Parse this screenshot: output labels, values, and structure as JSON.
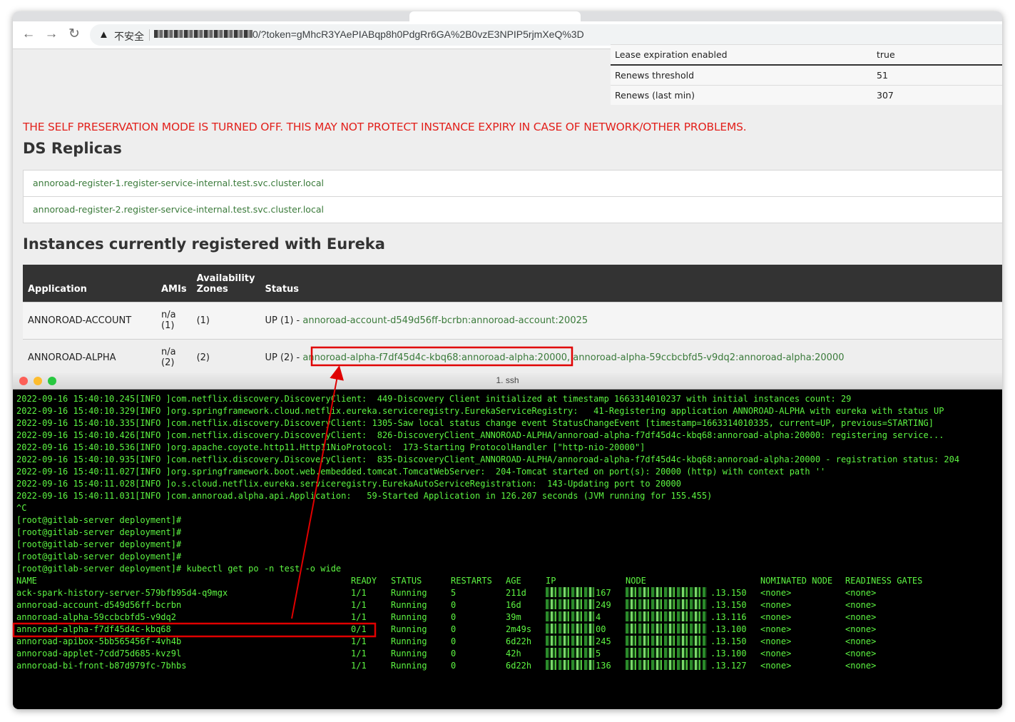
{
  "browser": {
    "security_label": "不安全",
    "url": "0/?token=gMhcR3YAePIABqp8h0PdgRr6GA%2B0vzE3NPIP5rjmXeQ%3D"
  },
  "lease_table": [
    {
      "label": "Lease expiration enabled",
      "value": "true"
    },
    {
      "label": "Renews threshold",
      "value": "51"
    },
    {
      "label": "Renews (last min)",
      "value": "307"
    }
  ],
  "warning": "THE SELF PRESERVATION MODE IS TURNED OFF. THIS MAY NOT PROTECT INSTANCE EXPIRY IN CASE OF NETWORK/OTHER PROBLEMS.",
  "ds_replicas": {
    "title": "DS Replicas",
    "items": [
      "annoroad-register-1.register-service-internal.test.svc.cluster.local",
      "annoroad-register-2.register-service-internal.test.svc.cluster.local"
    ]
  },
  "instances": {
    "title": "Instances currently registered with Eureka",
    "headers": {
      "application": "Application",
      "amis": "AMIs",
      "az_line1": "Availability",
      "az_line2": "Zones",
      "status": "Status"
    },
    "rows": [
      {
        "application": "ANNOROAD-ACCOUNT",
        "amis_1": "n/a",
        "amis_2": "(1)",
        "zones": "(1)",
        "status_prefix": "UP (1) -",
        "link1": "annoroad-account-d549d56ff-bcrbn:annoroad-account:20025",
        "link2": ""
      },
      {
        "application": "ANNOROAD-ALPHA",
        "amis_1": "n/a",
        "amis_2": "(2)",
        "zones": "(2)",
        "status_prefix": "UP (2) -",
        "link1": "annoroad-alpha-f7df45d4c-kbq68:annoroad-alpha:20000",
        "link2": ", annoroad-alpha-59ccbcbfd5-v9dq2:annoroad-alpha:20000"
      }
    ]
  },
  "terminal": {
    "title": "1. ssh",
    "log_lines": [
      "2022-09-16 15:40:10.245[INFO ]com.netflix.discovery.DiscoveryClient:  449-Discovery Client initialized at timestamp 1663314010237 with initial instances count: 29",
      "2022-09-16 15:40:10.329[INFO ]org.springframework.cloud.netflix.eureka.serviceregistry.EurekaServiceRegistry:   41-Registering application ANNOROAD-ALPHA with eureka with status UP",
      "2022-09-16 15:40:10.335[INFO ]com.netflix.discovery.DiscoveryClient: 1305-Saw local status change event StatusChangeEvent [timestamp=1663314010335, current=UP, previous=STARTING]",
      "2022-09-16 15:40:10.426[INFO ]com.netflix.discovery.DiscoveryClient:  826-DiscoveryClient_ANNOROAD-ALPHA/annoroad-alpha-f7df45d4c-kbq68:annoroad-alpha:20000: registering service...",
      "2022-09-16 15:40:10.536[INFO ]org.apache.coyote.http11.Http11NioProtocol:  173-Starting ProtocolHandler [\"http-nio-20000\"]",
      "2022-09-16 15:40:10.935[INFO ]com.netflix.discovery.DiscoveryClient:  835-DiscoveryClient_ANNOROAD-ALPHA/annoroad-alpha-f7df45d4c-kbq68:annoroad-alpha:20000 - registration status: 204",
      "2022-09-16 15:40:11.027[INFO ]org.springframework.boot.web.embedded.tomcat.TomcatWebServer:  204-Tomcat started on port(s): 20000 (http) with context path ''",
      "2022-09-16 15:40:11.028[INFO ]o.s.cloud.netflix.eureka.serviceregistry.EurekaAutoServiceRegistration:  143-Updating port to 20000",
      "2022-09-16 15:40:11.031[INFO ]com.annoroad.alpha.api.Application:   59-Started Application in 126.207 seconds (JVM running for 155.455)",
      "^C",
      "[root@gitlab-server deployment]#",
      "[root@gitlab-server deployment]#",
      "[root@gitlab-server deployment]#",
      "[root@gitlab-server deployment]#",
      "[root@gitlab-server deployment]# kubectl get po -n test -o wide"
    ],
    "columns": {
      "name": "NAME",
      "ready": "READY",
      "status": "STATUS",
      "restarts": "RESTARTS",
      "age": "AGE",
      "ip": "IP",
      "node": "NODE",
      "nominated": "NOMINATED NODE",
      "readiness": "READINESS GATES"
    },
    "pods": [
      {
        "name": "ack-spark-history-server-579bfb95d4-q9mgx",
        "ready": "1/1",
        "status": "Running",
        "restarts": "5",
        "age": "211d",
        "ip_tail": "167",
        "node_tail": ".13.150",
        "nominated": "<none>",
        "readiness": "<none>"
      },
      {
        "name": "annoroad-account-d549d56ff-bcrbn",
        "ready": "1/1",
        "status": "Running",
        "restarts": "0",
        "age": "16d",
        "ip_tail": "249",
        "node_tail": ".13.150",
        "nominated": "<none>",
        "readiness": "<none>"
      },
      {
        "name": "annoroad-alpha-59ccbcbfd5-v9dq2",
        "ready": "1/1",
        "status": "Running",
        "restarts": "0",
        "age": "39m",
        "ip_tail": "4",
        "node_tail": ".13.116",
        "nominated": "<none>",
        "readiness": "<none>"
      },
      {
        "name": "annoroad-alpha-f7df45d4c-kbq68",
        "ready": "0/1",
        "status": "Running",
        "restarts": "0",
        "age": "2m49s",
        "ip_tail": "00",
        "node_tail": ".13.100",
        "nominated": "<none>",
        "readiness": "<none>"
      },
      {
        "name": "annoroad-apibox-5bb565456f-4vh4b",
        "ready": "1/1",
        "status": "Running",
        "restarts": "0",
        "age": "6d22h",
        "ip_tail": "245",
        "node_tail": ".13.150",
        "nominated": "<none>",
        "readiness": "<none>"
      },
      {
        "name": "annoroad-applet-7cdd75d685-kvz9l",
        "ready": "1/1",
        "status": "Running",
        "restarts": "0",
        "age": "42h",
        "ip_tail": "5",
        "node_tail": ".13.100",
        "nominated": "<none>",
        "readiness": "<none>"
      },
      {
        "name": "annoroad-bi-front-b87d979fc-7bhbs",
        "ready": "1/1",
        "status": "Running",
        "restarts": "0",
        "age": "6d22h",
        "ip_tail": "136",
        "node_tail": ".13.127",
        "nominated": "<none>",
        "readiness": "<none>"
      }
    ]
  },
  "colors": {
    "terminal_text": "#5df542",
    "warning_red": "#e2211c",
    "link_green": "#3a7a3a",
    "annotation_red": "#e00000"
  }
}
